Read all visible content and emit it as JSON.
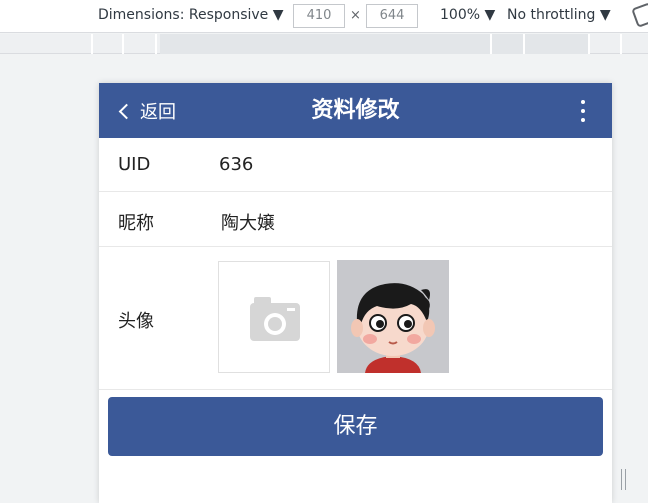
{
  "devtools": {
    "dimensions_label": "Dimensions: Responsive ▼",
    "width_value": "410",
    "times": "×",
    "height_value": "644",
    "zoom_label": "100% ▼",
    "throttling_label": "No throttling ▼",
    "rotate_icon": "rotate-icon"
  },
  "app": {
    "header": {
      "back_label": "返回",
      "title": "资料修改",
      "menu_icon": "more-vertical-icon",
      "color": "#3b5998"
    },
    "fields": {
      "uid_label": "UID",
      "uid_value": "636",
      "nickname_label": "昵称",
      "nickname_value": "陶大嬢",
      "avatar_label": "头像"
    },
    "avatar": {
      "upload_icon": "camera-icon",
      "current_icon": "cartoon-avatar"
    },
    "save_label": "保存"
  }
}
